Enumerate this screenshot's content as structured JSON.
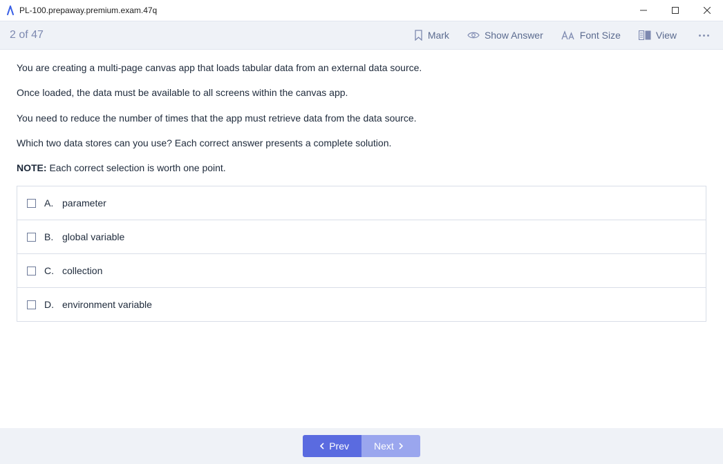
{
  "titlebar": {
    "text": "PL-100.prepaway.premium.exam.47q"
  },
  "toolbar": {
    "counter": "2 of 47",
    "mark": "Mark",
    "show_answer": "Show Answer",
    "font_size": "Font Size",
    "view": "View"
  },
  "question": {
    "p1": "You are creating a multi-page canvas app that loads tabular data from an external data source.",
    "p2": "Once loaded, the data must be available to all screens within the canvas app.",
    "p3": "You need to reduce the number of times that the app must retrieve data from the data source.",
    "p4": "Which two data stores can you use? Each correct answer presents a complete solution.",
    "note_label": "NOTE:",
    "note_text": " Each correct selection is worth one point."
  },
  "answers": [
    {
      "letter": "A.",
      "text": "parameter"
    },
    {
      "letter": "B.",
      "text": "global variable"
    },
    {
      "letter": "C.",
      "text": "collection"
    },
    {
      "letter": "D.",
      "text": "environment variable"
    }
  ],
  "footer": {
    "prev": "Prev",
    "next": "Next"
  }
}
